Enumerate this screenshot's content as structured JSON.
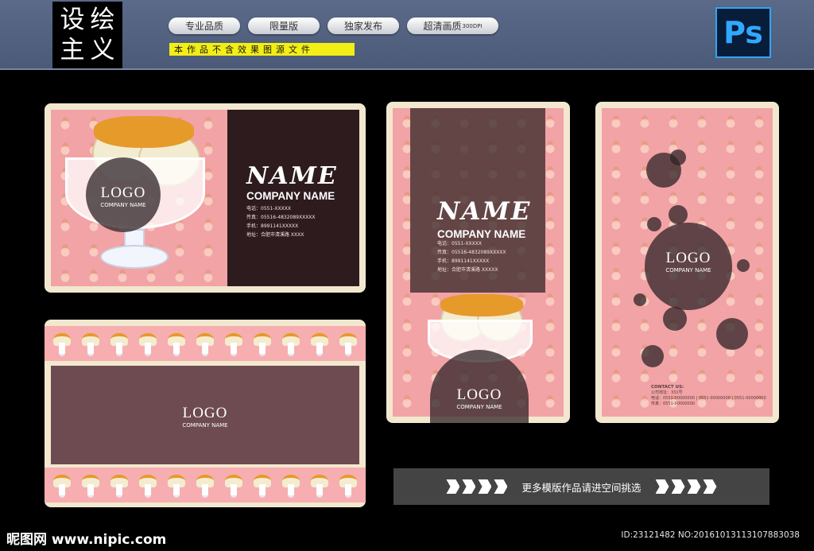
{
  "brand": {
    "chars": [
      "设",
      "绘",
      "主",
      "义"
    ]
  },
  "tags": [
    {
      "label": "专业品质",
      "extra": ""
    },
    {
      "label": "限量版",
      "extra": ""
    },
    {
      "label": "独家发布",
      "extra": ""
    },
    {
      "label": "超清画质",
      "extra": "300DPI"
    }
  ],
  "notice": "本作品不含效果图源文件",
  "ps_logo": "Ps",
  "card_front": {
    "logo": "LOGO",
    "logo_sub": "COMPANY NAME",
    "name": "NAME",
    "company": "COMPANY NAME",
    "info": [
      "电话：0551-XXXXX",
      "传真：05516-4832089XXXXX",
      "手机：8991141XXXXX",
      "地址：合肥市清溪路 XXXX"
    ]
  },
  "card_back": {
    "logo": "LOGO",
    "logo_sub": "COMPANY NAME"
  },
  "card_vertical": {
    "name": "NAME",
    "company": "COMPANY NAME",
    "info": [
      "电话：0551-XXXXX",
      "传真：05516-4832089XXXXX",
      "手机：8991141XXXXX",
      "地址：合肥市清溪路 XXXXX"
    ],
    "logo": "LOGO",
    "logo_sub": "COMPANY NAME"
  },
  "card_vertical2": {
    "logo": "LOGO",
    "logo_sub": "COMPANY NAME",
    "contact_title": "CONTACT US:",
    "contact_lines": [
      "公司地址：331号",
      "电话：0551-00000000 | 0551-00000000 | 0551-00000000",
      "传真：0551-00000000"
    ]
  },
  "promo": {
    "text": "更多模版作品请进空间挑选"
  },
  "footer": {
    "left": "昵图网 www.nipic.com",
    "right": "ID:23121482 NO:20161013113107883038"
  },
  "colors": {
    "pink": "#f2a3a6",
    "caramel": "#e59a2a",
    "cream": "#f2e8cf",
    "dark": "#3c2a2c"
  }
}
